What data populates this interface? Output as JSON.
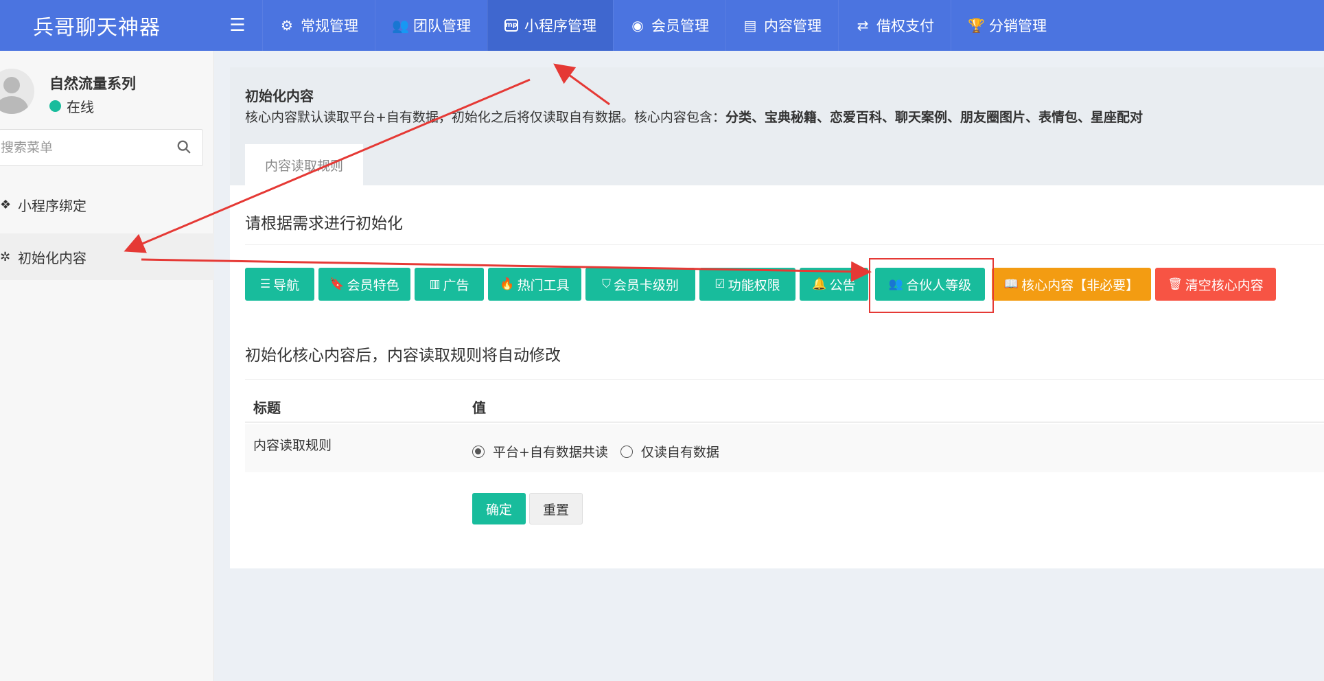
{
  "app": {
    "brand": "兵哥聊天神器"
  },
  "topnav": {
    "items": [
      {
        "label": "常规管理",
        "icon": "gears-icon"
      },
      {
        "label": "团队管理",
        "icon": "users-icon"
      },
      {
        "label": "小程序管理",
        "icon": "mp-icon",
        "active": true
      },
      {
        "label": "会员管理",
        "icon": "user-circle-icon"
      },
      {
        "label": "内容管理",
        "icon": "newspaper-icon"
      },
      {
        "label": "借权支付",
        "icon": "exchange-icon"
      },
      {
        "label": "分销管理",
        "icon": "trophy-icon"
      }
    ]
  },
  "sidebar": {
    "user": {
      "name": "自然流量系列",
      "status": "在线"
    },
    "search": {
      "placeholder": "搜索菜单"
    },
    "items": [
      {
        "label": "小程序绑定"
      },
      {
        "label": "初始化内容",
        "active": true
      }
    ]
  },
  "content": {
    "title": "初始化内容",
    "description_prefix": "核心内容默认读取平台+自有数据，初始化之后将仅读取自有数据。核心内容包含：",
    "description_bold": "分类、宝典秘籍、恋爱百科、聊天案例、朋友圈图片、表情包、星座配对",
    "tab": "内容读取规则",
    "section1_title": "请根据需求进行初始化",
    "buttons": [
      {
        "label": "导航",
        "color": "green",
        "icon": "list-icon"
      },
      {
        "label": "会员特色",
        "color": "green",
        "icon": "bookmark-icon"
      },
      {
        "label": "广告",
        "color": "green",
        "icon": "map-icon"
      },
      {
        "label": "热门工具",
        "color": "green",
        "icon": "fire-icon"
      },
      {
        "label": "会员卡级别",
        "color": "green",
        "icon": "shield-icon"
      },
      {
        "label": "功能权限",
        "color": "green",
        "icon": "check-square-icon"
      },
      {
        "label": "公告",
        "color": "green",
        "icon": "bell-icon"
      },
      {
        "label": "合伙人等级",
        "color": "green",
        "icon": "users-icon"
      },
      {
        "label": "核心内容【非必要】",
        "color": "orange",
        "icon": "book-icon"
      },
      {
        "label": "清空核心内容",
        "color": "red",
        "icon": "trash-icon"
      }
    ],
    "section2_title": "初始化核心内容后，内容读取规则将自动修改",
    "table": {
      "headers": [
        "标题",
        "值"
      ],
      "row": {
        "label": "内容读取规则",
        "options": [
          "平台+自有数据共读",
          "仅读自有数据"
        ],
        "selected": "平台+自有数据共读"
      }
    },
    "confirm": "确定",
    "reset": "重置"
  },
  "colors": {
    "navbar": "#4b74e0",
    "success": "#18bc9c",
    "warning": "#f39c12",
    "danger": "#f75444",
    "annotation": "#e53935"
  }
}
